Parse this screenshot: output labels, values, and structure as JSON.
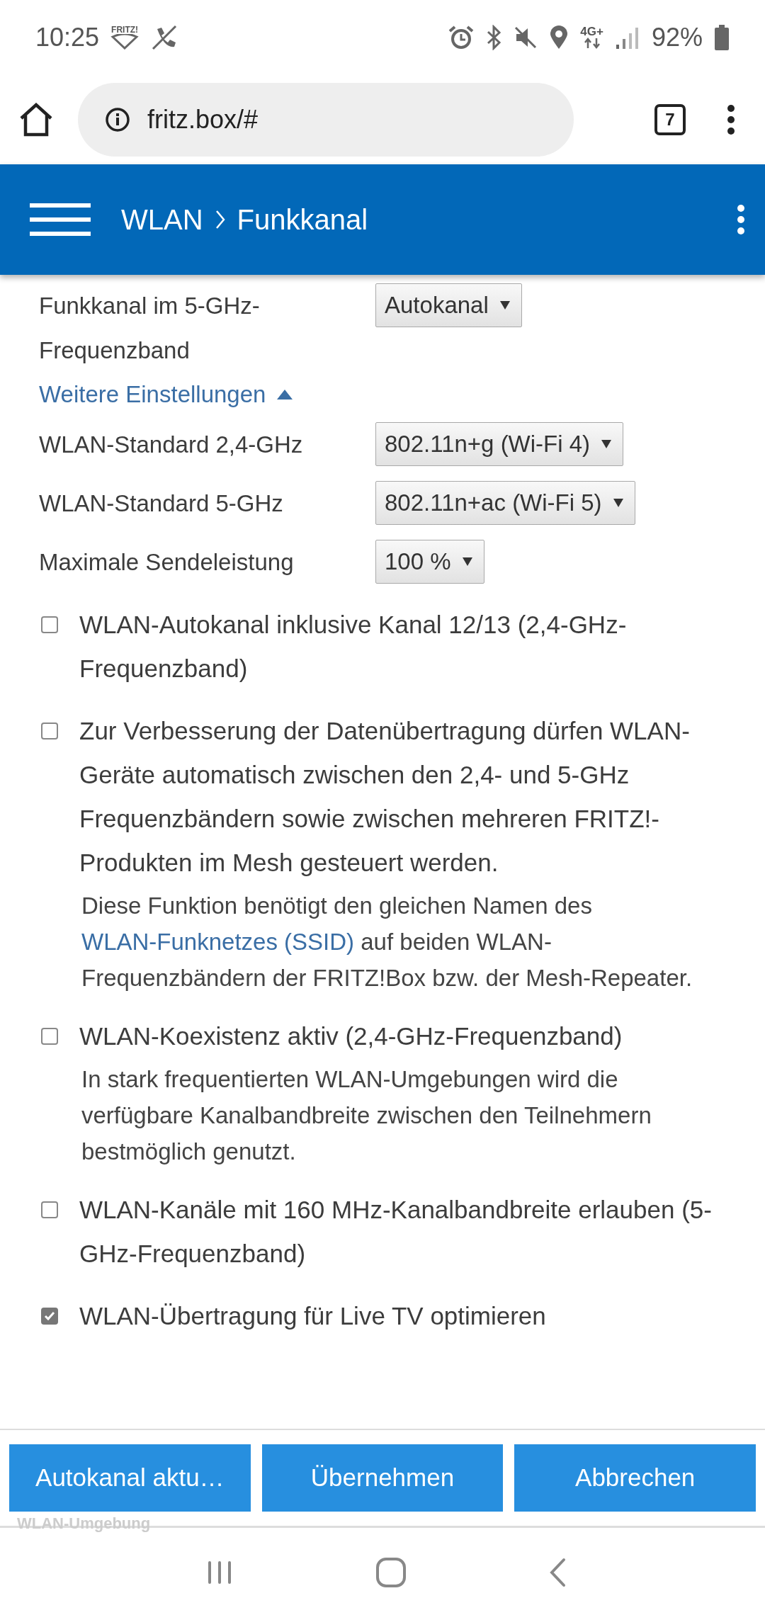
{
  "status_bar": {
    "time": "10:25",
    "wifi_label": "FRITZ!",
    "network": "4G+",
    "battery": "92%"
  },
  "browser": {
    "url": "fritz.box/#",
    "tab_count": "7"
  },
  "header": {
    "breadcrumb": [
      "WLAN",
      "Funkkanal"
    ]
  },
  "fields": [
    {
      "label": "Funkkanal im 5-GHz-Frequenzband",
      "value": "Autokanal"
    }
  ],
  "more_settings": {
    "label": "Weitere Einstellungen",
    "expanded": true
  },
  "advanced_fields": [
    {
      "label": "WLAN-Standard 2,4-GHz",
      "value": "802.11n+g (Wi-Fi 4)"
    },
    {
      "label": "WLAN-Standard 5-GHz",
      "value": "802.11n+ac (Wi-Fi 5)"
    },
    {
      "label": "Maximale Sendeleistung",
      "value": "100 %"
    }
  ],
  "options": [
    {
      "label": "WLAN-Autokanal inklusive Kanal 12/13 (2,4-GHz-Frequenzband)",
      "checked": false
    },
    {
      "label": "Zur Verbesserung der Datenübertragung dürfen WLAN-Geräte automatisch zwischen den 2,4- und 5-GHz Frequenzbändern sowie zwischen mehreren FRITZ!-Produkten im Mesh gesteuert werden.",
      "checked": false,
      "description": [
        {
          "kind": "text",
          "text": "Diese Funktion benötigt den gleichen Namen des "
        },
        {
          "kind": "link",
          "text": "WLAN-Funknetzes (SSID)"
        },
        {
          "kind": "text",
          "text": " auf beiden WLAN-Frequenzbändern der FRITZ!Box bzw. der Mesh-Repeater."
        }
      ]
    },
    {
      "label": "WLAN-Koexistenz aktiv (2,4-GHz-Frequenzband)",
      "checked": false,
      "description": [
        {
          "kind": "text",
          "text": "In stark frequentierten WLAN-Umgebungen wird die verfügbare Kanalbandbreite zwischen den Teilnehmern bestmöglich genutzt."
        }
      ]
    },
    {
      "label": "WLAN-Kanäle mit 160 MHz-Kanalbandbreite erlauben (5-GHz-Frequenzband)",
      "checked": false
    },
    {
      "label": "WLAN-Übertragung für Live TV optimieren",
      "checked": true
    }
  ],
  "footer_buttons": [
    "Autokanal aktu…",
    "Übernehmen",
    "Abbrechen"
  ],
  "below_footer": "WLAN-Umgebung"
}
